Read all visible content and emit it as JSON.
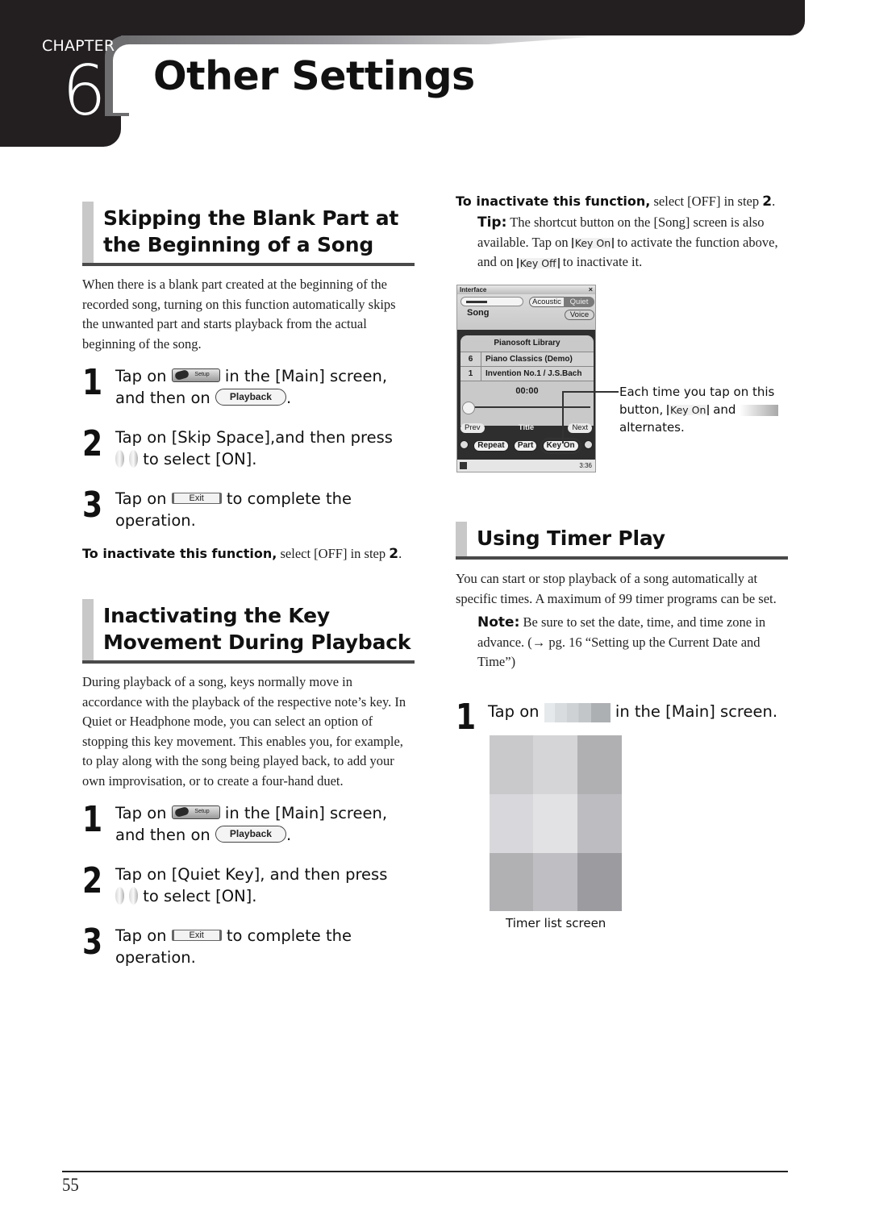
{
  "header": {
    "chapter_label": "CHAPTER",
    "chapter_number": "6",
    "title": "Other Settings"
  },
  "section_skip": {
    "heading": "Skipping the Blank Part at the Beginning of a Song",
    "body": "When there is a blank part created at the beginning of the recorded song, turning on this function automatically skips the unwanted part and starts playback from the actual beginning of the song.",
    "steps": [
      {
        "number": "1",
        "pre": "Tap on",
        "mid": "in the [Main] screen, and then on",
        "post": "."
      },
      {
        "number": "2",
        "pre": "Tap on [Skip Space],and then press",
        "post": "to select [ON]."
      },
      {
        "number": "3",
        "pre": "Tap on",
        "post": "to complete the operation."
      }
    ],
    "inactivate_bold": "To inactivate this function,",
    "inactivate_text": "select [OFF] in step",
    "inactivate_step": "2",
    "inactivate_end": "."
  },
  "section_key": {
    "heading": "Inactivating the Key Movement During Playback",
    "body": "During playback of a song, keys normally move in accordance with the playback of the respective note’s key. In Quiet or Headphone mode, you can select an option of stopping this key movement. This enables you, for example, to play along with the song being played back, to add your own improvisation, or to create a four-hand duet.",
    "steps": [
      {
        "number": "1",
        "pre": "Tap on",
        "mid": "in the [Main] screen, and then on",
        "post": "."
      },
      {
        "number": "2",
        "pre": "Tap on [Quiet Key], and then press",
        "post": "to select [ON]."
      },
      {
        "number": "3",
        "pre": "Tap on",
        "post": "to complete the operation."
      }
    ],
    "inactivate_bold": "To inactivate this function,",
    "inactivate_text": "select [OFF] in step",
    "inactivate_step": "2",
    "inactivate_end": ".",
    "tip_label": "Tip:",
    "tip_pre": "The shortcut button on the [Song] screen is also available. Tap on",
    "tip_mid": "to activate the function above, and on",
    "tip_post": "to inactivate it."
  },
  "buttons": {
    "setup": "Setup",
    "playback": "Playback",
    "exit": "Exit",
    "key_on": "Key On",
    "key_off": "Key Off"
  },
  "song_screen": {
    "window_title": "Interface",
    "close": "×",
    "acoustic": "Acoustic",
    "quiet": "Quiet",
    "song": "Song",
    "voice": "Voice",
    "library": "Pianosoft Library",
    "rows": [
      {
        "num": "6",
        "title": "Piano Classics (Demo)"
      },
      {
        "num": "1",
        "title": "Invention No.1 / J.S.Bach"
      }
    ],
    "time": "00:00",
    "prev": "Prev",
    "title_label": "Title",
    "next": "Next",
    "repeat": "Repeat",
    "part": "Part",
    "key_on": "Key On",
    "clock": "3:36"
  },
  "callout": {
    "pre": "Each time you tap on this button,",
    "mid": "and",
    "post": "alternates."
  },
  "section_timer": {
    "heading": "Using Timer Play",
    "body": "You can start or stop playback of a song automatically at specific times. A maximum of 99 timer programs can be set.",
    "note_label": "Note:",
    "note_text": "Be sure to set the date, time, and time zone in advance. (→ pg. 16 “Setting up the Current Date and Time”)",
    "step_number": "1",
    "step_pre": "Tap on",
    "step_post": "in the [Main] screen.",
    "caption": "Timer list screen",
    "placeholder_colors": [
      "#c9c9cc",
      "#d5d5d8",
      "#b0b0b3",
      "#d8d8dc",
      "#e2e2e5",
      "#bdbdc1",
      "#b1b1b4",
      "#bfbfc3",
      "#9c9ca0"
    ]
  },
  "footer": {
    "page_number": "55"
  }
}
